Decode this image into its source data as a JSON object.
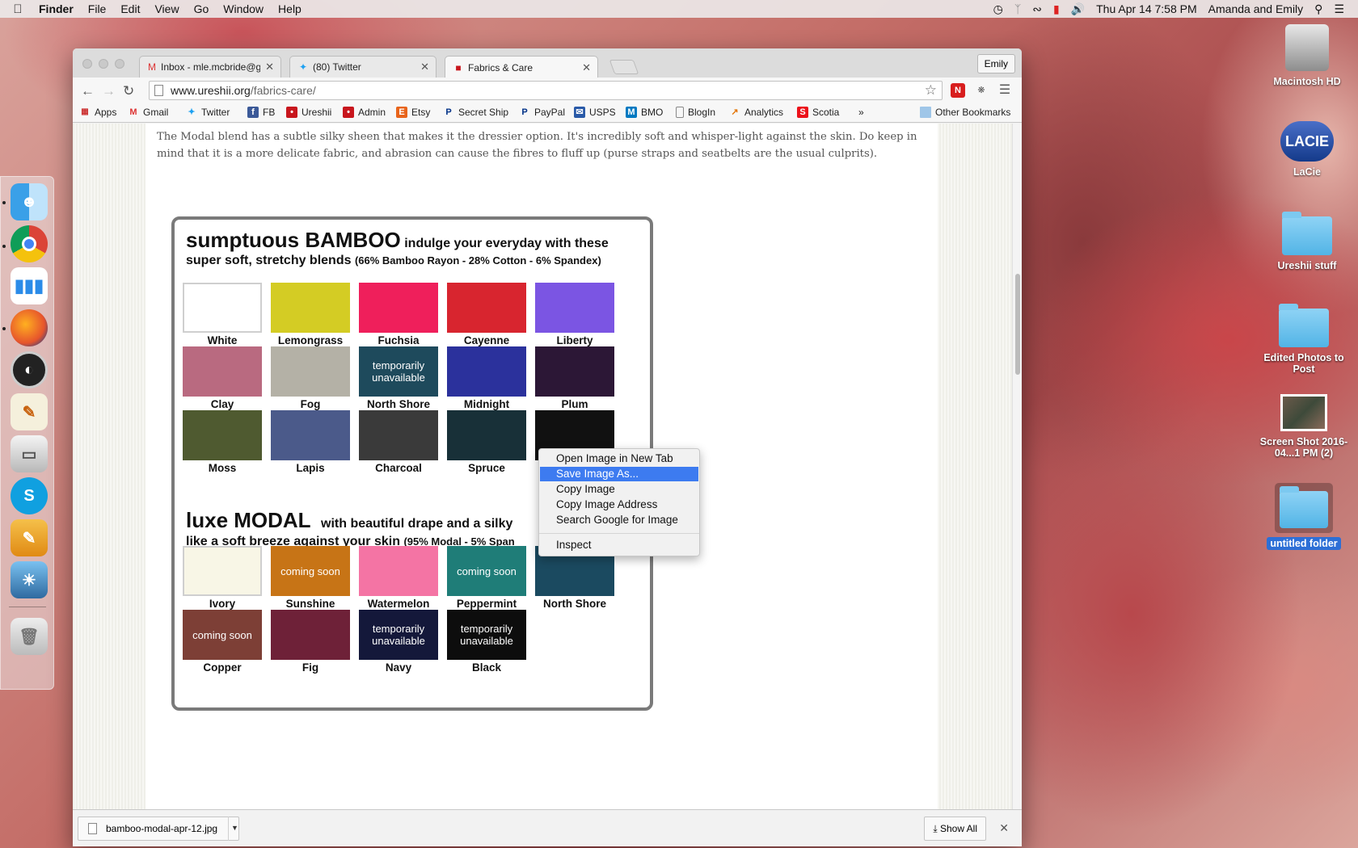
{
  "menubar": {
    "apple": "",
    "items": [
      "Finder",
      "File",
      "Edit",
      "View",
      "Go",
      "Window",
      "Help"
    ],
    "datetime": "Thu Apr 14  7:58 PM",
    "user": "Amanda and Emily"
  },
  "browser": {
    "tabs": [
      {
        "title": "Inbox - mle.mcbride@gma",
        "icon": "gmail-icon"
      },
      {
        "title": "(80) Twitter",
        "icon": "twitter-icon"
      },
      {
        "title": "Fabrics & Care",
        "icon": "ureshii-icon"
      }
    ],
    "profile": "Emily",
    "url_domain": "www.ureshii.org",
    "url_path": "/fabrics-care/",
    "bookmarks": [
      "Apps",
      "Gmail",
      "Twitter",
      "FB",
      "Ureshii",
      "Admin",
      "Etsy",
      "Secret Ship",
      "PayPal",
      "USPS",
      "BMO",
      "BlogIn",
      "Analytics",
      "Scotia"
    ],
    "bookmarks_more": "»",
    "other_bookmarks": "Other Bookmarks"
  },
  "page": {
    "paragraph": "The Modal blend has a subtle silky sheen that makes it the dressier option. It's incredibly soft and whisper-light against the skin. Do keep in mind that it is a more delicate fabric, and abrasion can cause the fibres to fluff up (purse straps and seatbelts are the usual culprits)."
  },
  "fabric_chart": {
    "bamboo_title": "sumptuous BAMBOO",
    "bamboo_tagline": "indulge your everyday with these",
    "bamboo_sub": "super soft, stretchy blends",
    "bamboo_blend": "(66% Bamboo Rayon - 28% Cotton - 6% Spandex)",
    "modal_title": "luxe MODAL",
    "modal_tagline": "with beautiful drape and a silky",
    "modal_sub": "like a soft breeze against your skin",
    "modal_blend": "(95% Modal - 5% Span",
    "bamboo_swatches": [
      {
        "name": "White",
        "color": "#ffffff",
        "note": ""
      },
      {
        "name": "Lemongrass",
        "color": "#d4cc24",
        "note": ""
      },
      {
        "name": "Fuchsia",
        "color": "#ef1f5b",
        "note": ""
      },
      {
        "name": "Cayenne",
        "color": "#d8252f",
        "note": ""
      },
      {
        "name": "Liberty",
        "color": "#7b55e3",
        "note": ""
      },
      {
        "name": "Clay",
        "color": "#b96a80",
        "note": ""
      },
      {
        "name": "Fog",
        "color": "#b4b1a6",
        "note": ""
      },
      {
        "name": "North Shore",
        "color": "#1e4a5c",
        "note": "temporarily unavailable"
      },
      {
        "name": "Midnight",
        "color": "#2b319c",
        "note": ""
      },
      {
        "name": "Plum",
        "color": "#2c1736",
        "note": ""
      },
      {
        "name": "Moss",
        "color": "#4f5a30",
        "note": ""
      },
      {
        "name": "Lapis",
        "color": "#4b5a8a",
        "note": ""
      },
      {
        "name": "Charcoal",
        "color": "#3a3a3a",
        "note": ""
      },
      {
        "name": "Spruce",
        "color": "#183038",
        "note": ""
      },
      {
        "name": "",
        "color": "#111111",
        "note": ""
      }
    ],
    "modal_swatches": [
      {
        "name": "Ivory",
        "color": "#f8f6e6",
        "note": ""
      },
      {
        "name": "Sunshine",
        "color": "#c77416",
        "note": "coming soon"
      },
      {
        "name": "Watermelon",
        "color": "#f474a4",
        "note": ""
      },
      {
        "name": "Peppermint",
        "color": "#1f7d78",
        "note": "coming soon"
      },
      {
        "name": "North Shore",
        "color": "#1b4a60",
        "note": ""
      },
      {
        "name": "Copper",
        "color": "#7d3f36",
        "note": "coming soon"
      },
      {
        "name": "Fig",
        "color": "#6e2138",
        "note": ""
      },
      {
        "name": "Navy",
        "color": "#14183a",
        "note": "temporarily unavailable"
      },
      {
        "name": "Black",
        "color": "#0d0d0d",
        "note": "temporarily unavailable"
      }
    ]
  },
  "context_menu": {
    "items": [
      "Open Image in New Tab",
      "Save Image As...",
      "Copy Image",
      "Copy Image Address",
      "Search Google for Image"
    ],
    "inspect": "Inspect",
    "selected_index": 1
  },
  "download_bar": {
    "filename": "bamboo-modal-apr-12.jpg",
    "show_all": "Show All"
  },
  "desktop": {
    "icons": [
      {
        "label": "Macintosh HD",
        "kind": "drive"
      },
      {
        "label": "LaCie",
        "kind": "lacie",
        "badge": "LACIE"
      },
      {
        "label": "Ureshii stuff",
        "kind": "folder"
      },
      {
        "label": "Edited Photos to Post",
        "kind": "folder"
      },
      {
        "label": "Screen Shot 2016-04...1 PM (2)",
        "kind": "screenshot"
      },
      {
        "label": "untitled folder",
        "kind": "folder"
      }
    ]
  }
}
